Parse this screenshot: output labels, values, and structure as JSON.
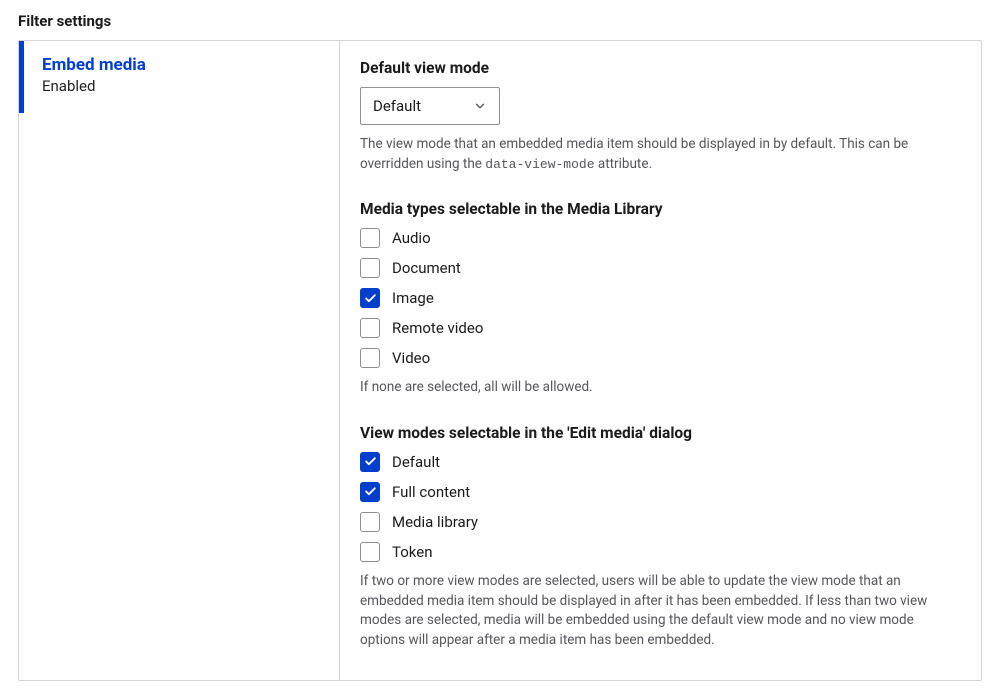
{
  "pageTitle": "Filter settings",
  "tab": {
    "title": "Embed media",
    "status": "Enabled"
  },
  "defaultViewMode": {
    "heading": "Default view mode",
    "selected": "Default",
    "help_before": "The view mode that an embedded media item should be displayed in by default. This can be overridden using the ",
    "help_code": "data-view-mode",
    "help_after": " attribute."
  },
  "mediaTypes": {
    "heading": "Media types selectable in the Media Library",
    "options": [
      {
        "label": "Audio",
        "checked": false
      },
      {
        "label": "Document",
        "checked": false
      },
      {
        "label": "Image",
        "checked": true
      },
      {
        "label": "Remote video",
        "checked": false
      },
      {
        "label": "Video",
        "checked": false
      }
    ],
    "help": "If none are selected, all will be allowed."
  },
  "viewModes": {
    "heading": "View modes selectable in the 'Edit media' dialog",
    "options": [
      {
        "label": "Default",
        "checked": true
      },
      {
        "label": "Full content",
        "checked": true
      },
      {
        "label": "Media library",
        "checked": false
      },
      {
        "label": "Token",
        "checked": false
      }
    ],
    "help": "If two or more view modes are selected, users will be able to update the view mode that an embedded media item should be displayed in after it has been embedded. If less than two view modes are selected, media will be embedded using the default view mode and no view mode options will appear after a media item has been embedded."
  }
}
